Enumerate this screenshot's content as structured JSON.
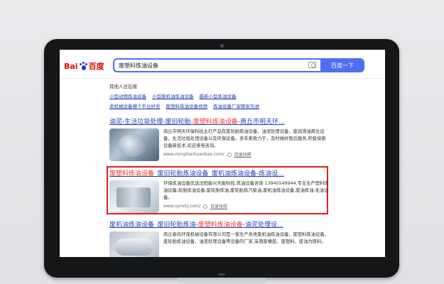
{
  "search": {
    "query": "废塑料炼油设备",
    "button_label": "百度一下"
  },
  "logo": {
    "text_left": "Bai",
    "text_right": "百度"
  },
  "related": {
    "title": "其他人还在搜",
    "items": [
      "小型动物炼油设备",
      "小型废机油炼油设备",
      "最新小型炼油设备",
      "卖机械设备哪个平台好卖",
      "废塑料炼油设备视频",
      "炼油设备厂家哪家先进"
    ]
  },
  "results": [
    {
      "title_pre": "油泥-生活垃圾处理-废旧轮胎-",
      "title_em": "废塑料炼油设备",
      "title_post": "-商丘市明天环...",
      "desc": "商丘市明天环保科技主打产品有废轮胎炼油设备，油泥处理设备，废润滑油再生设备，生活垃圾处理设备以及环保设备。多年来致力于，及时做好售后服务,积极探索设备新技术,欢迎来电咨询。",
      "url": "www.mingtianhuanbao.com/",
      "snapshot": "百度快照"
    },
    {
      "title_em": "废塑料炼油设备",
      "title_post": "_废旧轮胎炼油设备_废机油炼油设备-炼油设...",
      "desc": "环保炼油设备优选沈阳能兴天能科技,炼油设备咨询 13940549944,专业生产塑料炼油设备,轮胎炼油设备,废轮胎炼油,废轮胎炼汽柴油,废机油炼油设备,废油炼油,毛油设备。",
      "url": "www.synxkj.com/",
      "snapshot": "百度快照"
    },
    {
      "title_pre": "废机油炼油设备_废旧轮胎炼油-",
      "title_em": "废塑料炼油设备",
      "title_post": "-油泥处理设...",
      "desc": "商丘泰尚环保机械设备有限公司是一家生产各类废机油炼油设备，废塑料炼油设备，废轮胎炼油设备，油泥处理设备等设备的厂家,采用废橡胶，废塑料，废油为原料。",
      "url": "",
      "snapshot": ""
    }
  ],
  "colors": {
    "link": "#2440b3",
    "highlight": "#f73131",
    "brand_blue": "#4e6ef2",
    "annotation_box": "#e21e1e"
  }
}
